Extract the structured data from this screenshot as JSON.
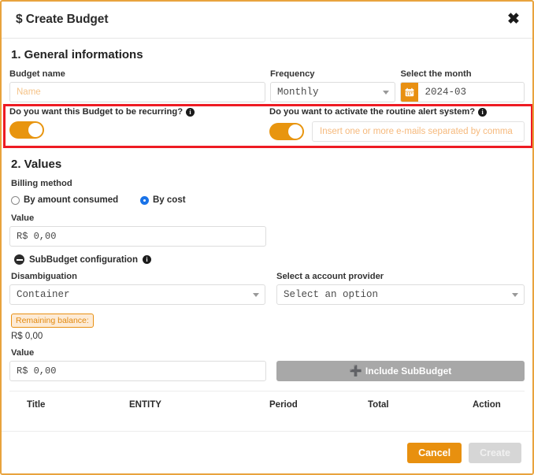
{
  "header": {
    "currency_symbol": "$",
    "title": "Create Budget",
    "close_label": "✖"
  },
  "section_general": {
    "title": "1. General informations",
    "budget_name": {
      "label": "Budget name",
      "value": "",
      "placeholder": "Name"
    },
    "frequency": {
      "label": "Frequency",
      "selected": "Monthly"
    },
    "month": {
      "label": "Select the month",
      "value": "2024-03",
      "icon": "calendar-icon"
    },
    "recurring": {
      "question": "Do you want this Budget to be recurring?",
      "info_glyph": "i",
      "state": "on"
    },
    "alert_system": {
      "question": "Do you want to activate the routine alert system?",
      "info_glyph": "i",
      "state": "on",
      "email_value": "",
      "email_placeholder": "Insert one or more e-mails separated by comma"
    }
  },
  "section_values": {
    "title": "2. Values",
    "billing_method": {
      "label": "Billing method",
      "options": [
        {
          "label": "By amount consumed",
          "checked": false
        },
        {
          "label": "By cost",
          "checked": true
        }
      ]
    },
    "value": {
      "label": "Value",
      "value": "R$ 0,00"
    },
    "subbudget": {
      "header": "SubBudget configuration",
      "info_glyph": "i",
      "disambiguation": {
        "label": "Disambiguation",
        "selected": "Container"
      },
      "account_provider": {
        "label": "Select a account provider",
        "selected": "Select an option"
      },
      "remaining_balance": {
        "badge": "Remaining balance:",
        "value": "R$ 0,00"
      },
      "sub_value": {
        "label": "Value",
        "value": "R$ 0,00"
      },
      "include_button": {
        "label": "Include SubBudget",
        "icon": "plus-icon"
      },
      "table": {
        "columns": [
          "Title",
          "ENTITY",
          "Period",
          "Total",
          "Action"
        ],
        "rows": []
      }
    }
  },
  "footer": {
    "cancel_label": "Cancel",
    "create_label": "Create"
  },
  "colors": {
    "accent": "#e8900f",
    "frame": "#e8a33d",
    "highlight": "#ee1b23",
    "radio_selected": "#1a73e8",
    "disabled": "#a8a8a8"
  }
}
